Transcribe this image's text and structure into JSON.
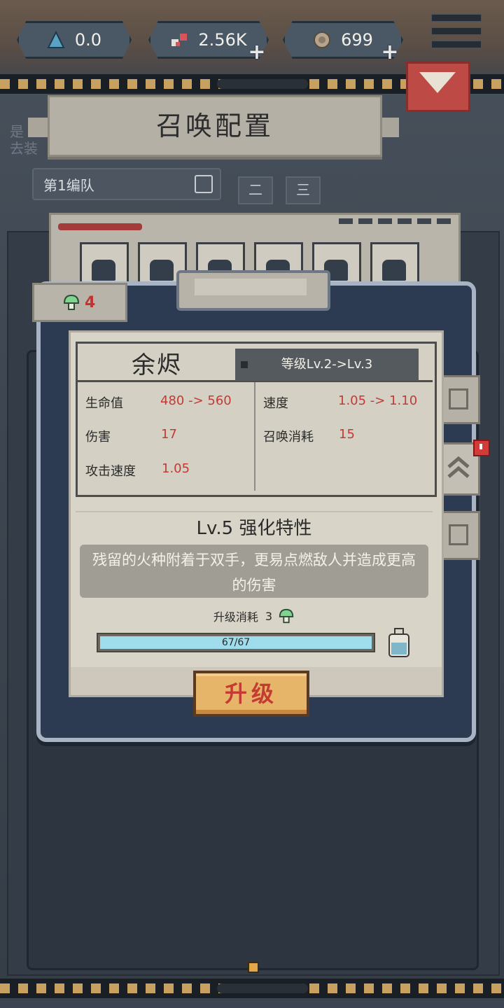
{
  "resources": [
    {
      "name": "crystal",
      "value": "0.0",
      "color": "#5aa3c4",
      "has_plus": false
    },
    {
      "name": "gems",
      "value": "2.56K",
      "color": "#d8545a",
      "has_plus": true
    },
    {
      "name": "coins",
      "value": "699",
      "color": "#b6a58e",
      "has_plus": true
    }
  ],
  "header": {
    "title": "召唤配置",
    "background_hint": "是\n去装"
  },
  "team": {
    "selected": "第1编队",
    "tabs": [
      "二",
      "三"
    ]
  },
  "popup": {
    "summon_cost": "4",
    "unit_name": "余烬",
    "level_change": "等级Lv.2->Lv.3",
    "stats": [
      {
        "label": "生命值",
        "value": "480 -> 560"
      },
      {
        "label": "速度",
        "value": "1.05 -> 1.10"
      },
      {
        "label": "伤害",
        "value": "17"
      },
      {
        "label": "召唤消耗",
        "value": "15"
      },
      {
        "label": "攻击速度",
        "value": "1.05"
      }
    ],
    "trait_title": "Lv.5 强化特性",
    "trait_description": "残留的火种附着于双手，更易点燃敌人并造成更高的伤害",
    "upgrade_cost_label": "升级消耗",
    "upgrade_cost_value": "3",
    "exp_text": "67/67",
    "exp_fraction": 1.0,
    "upgrade_button": "升级"
  },
  "side_tabs": [
    "book-icon",
    "upgrade-arrows-icon",
    "armor-icon"
  ],
  "colors": {
    "accent_red": "#c23a36",
    "exp_bar": "#9fdcec",
    "button_gold": "#e6b56a"
  }
}
